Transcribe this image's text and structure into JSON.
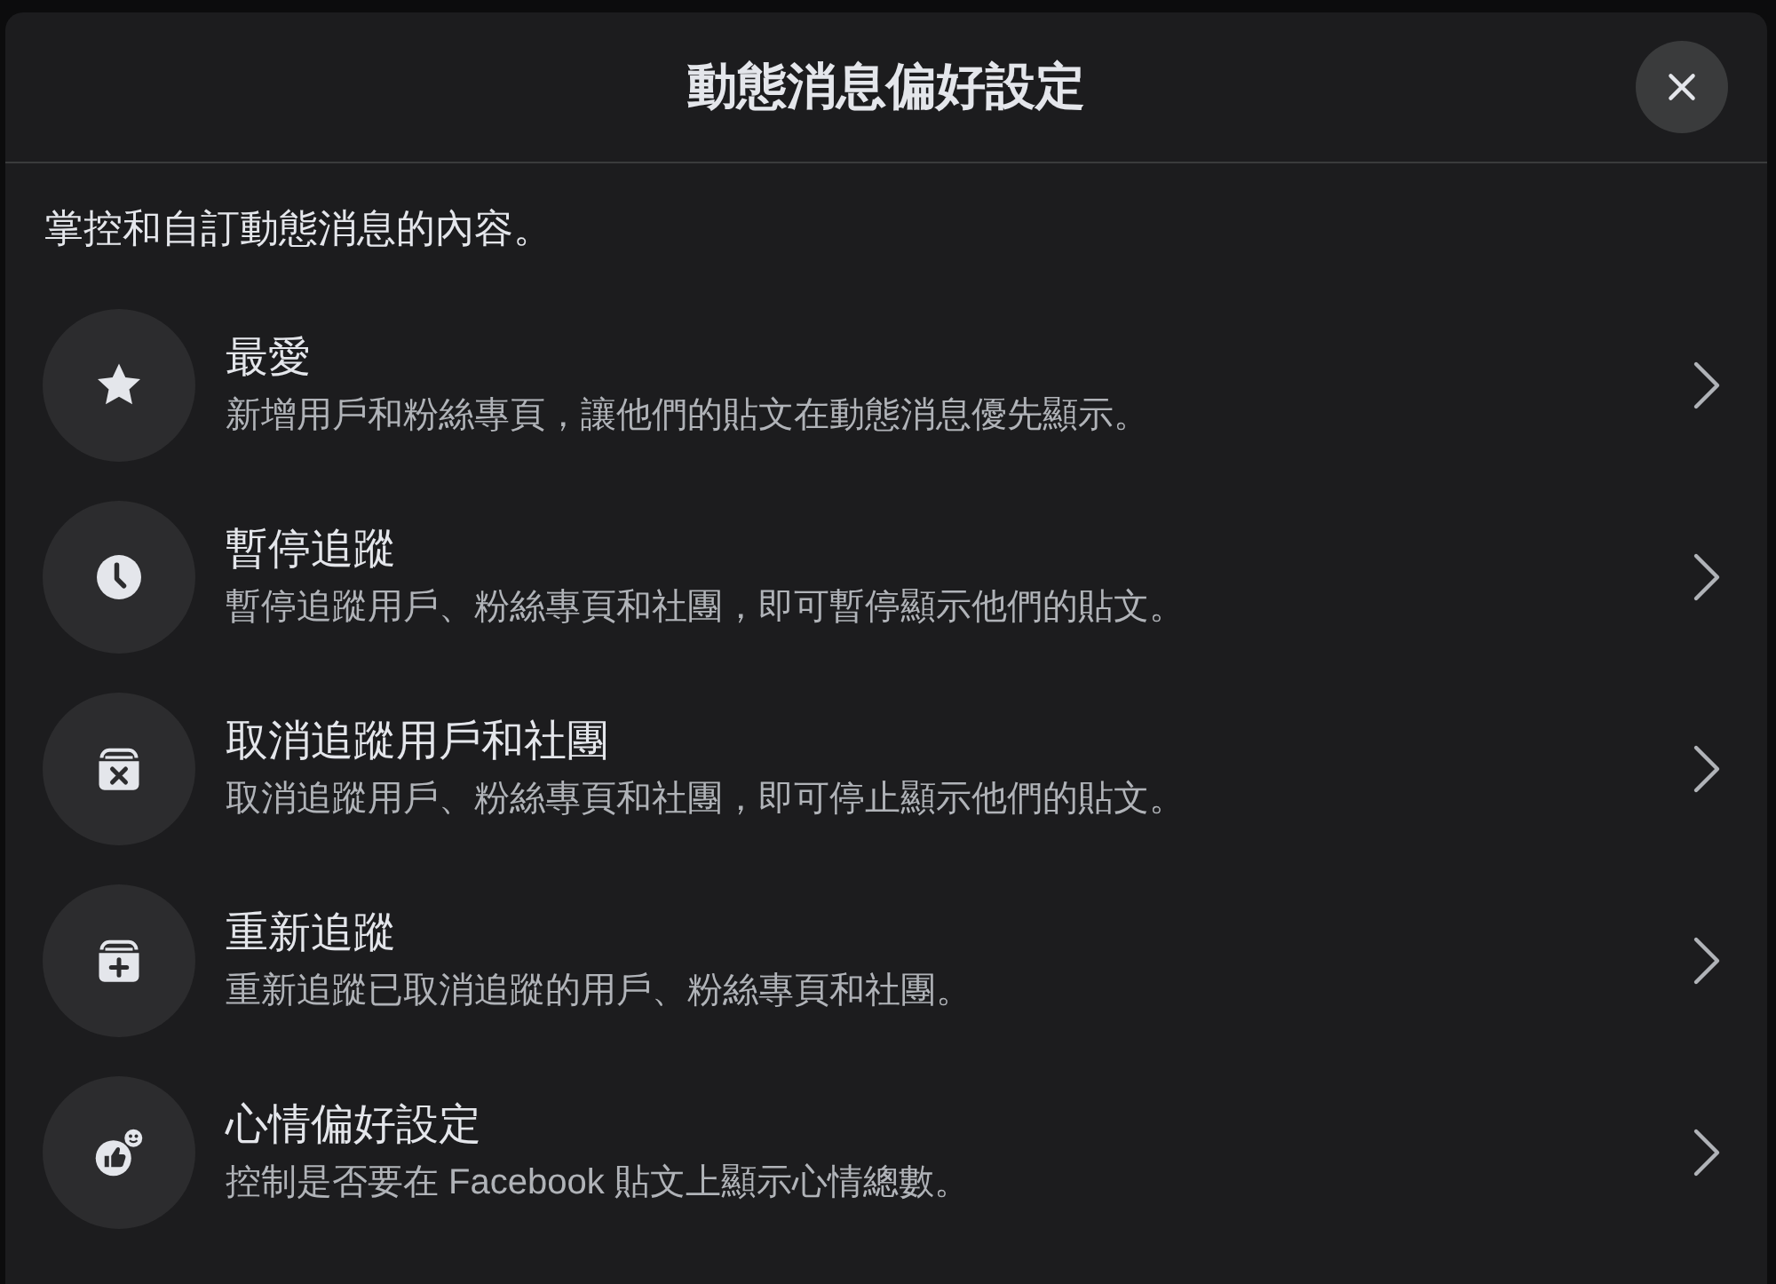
{
  "dialog": {
    "title": "動態消息偏好設定",
    "subtitle": "掌控和自訂動態消息的內容。",
    "items": [
      {
        "kind": "star",
        "title": "最愛",
        "description": "新增用戶和粉絲專頁，讓他們的貼文在動態消息優先顯示。"
      },
      {
        "kind": "clock",
        "title": "暫停追蹤",
        "description": "暫停追蹤用戶、粉絲專頁和社團，即可暫停顯示他們的貼文。"
      },
      {
        "kind": "box-x",
        "title": "取消追蹤用戶和社團",
        "description": "取消追蹤用戶、粉絲專頁和社團，即可停止顯示他們的貼文。"
      },
      {
        "kind": "box-plus",
        "title": "重新追蹤",
        "description": "重新追蹤已取消追蹤的用戶、粉絲專頁和社團。"
      },
      {
        "kind": "reactions",
        "title": "心情偏好設定",
        "description": "控制是否要在 Facebook 貼文上顯示心情總數。"
      }
    ]
  }
}
